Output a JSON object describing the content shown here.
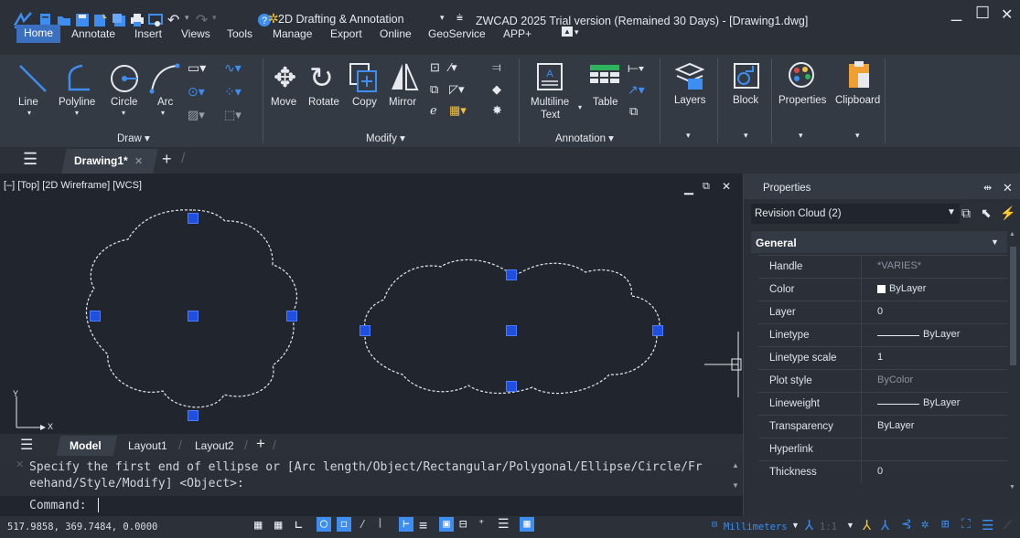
{
  "app": {
    "title": "ZWCAD 2025 Trial version (Remained 30 Days) - [Drawing1.dwg]",
    "workspace": "2D Drafting & Annotation",
    "minimize": "_",
    "maximize": "☐",
    "close": "✕"
  },
  "menu": [
    "Home",
    "Annotate",
    "Insert",
    "Views",
    "Tools",
    "Manage",
    "Export",
    "Online",
    "GeoService",
    "APP+"
  ],
  "ribbon": {
    "draw": {
      "line": "Line",
      "polyline": "Polyline",
      "circle": "Circle",
      "arc": "Arc",
      "group": "Draw ▾"
    },
    "modify": {
      "move": "Move",
      "rotate": "Rotate",
      "copy": "Copy",
      "mirror": "Mirror",
      "group": "Modify ▾"
    },
    "annotation": {
      "multiline_1": "Multiline",
      "multiline_2": "Text",
      "table": "Table",
      "group": "Annotation ▾"
    },
    "layers": "Layers",
    "block": "Block",
    "properties": "Properties",
    "clipboard": "Clipboard"
  },
  "doctab": {
    "name": "Drawing1*",
    "close": "✕",
    "add": "+"
  },
  "viewport": {
    "label": "[–] [Top] [2D Wireframe] [WCS]",
    "axis_y": "Y",
    "axis_x": "X"
  },
  "layout_tabs": {
    "model": "Model",
    "layout1": "Layout1",
    "layout2": "Layout2",
    "add": "+"
  },
  "command": {
    "history_line1": "Specify the first end of ellipse or [Arc length/Object/Rectangular/Polygonal/Ellipse/Circle/Fr",
    "history_line2": "eehand/Style/Modify] <Object>:",
    "prompt": "Command:"
  },
  "status": {
    "coords": "517.9858, 369.7484, 0.0000",
    "units": "Millimeters",
    "scale": "1:1"
  },
  "properties": {
    "title": "Properties",
    "selection": "Revision Cloud (2)",
    "section": "General",
    "rows": [
      {
        "key": "Handle",
        "value": "*VARIES*",
        "dim": true
      },
      {
        "key": "Color",
        "value": "ByLayer"
      },
      {
        "key": "Layer",
        "value": "0"
      },
      {
        "key": "Linetype",
        "value": "ByLayer"
      },
      {
        "key": "Linetype scale",
        "value": "1"
      },
      {
        "key": "Plot style",
        "value": "ByColor",
        "dim": true
      },
      {
        "key": "Lineweight",
        "value": "ByLayer"
      },
      {
        "key": "Transparency",
        "value": "ByLayer"
      },
      {
        "key": "Hyperlink",
        "value": ""
      },
      {
        "key": "Thickness",
        "value": "0"
      }
    ]
  }
}
